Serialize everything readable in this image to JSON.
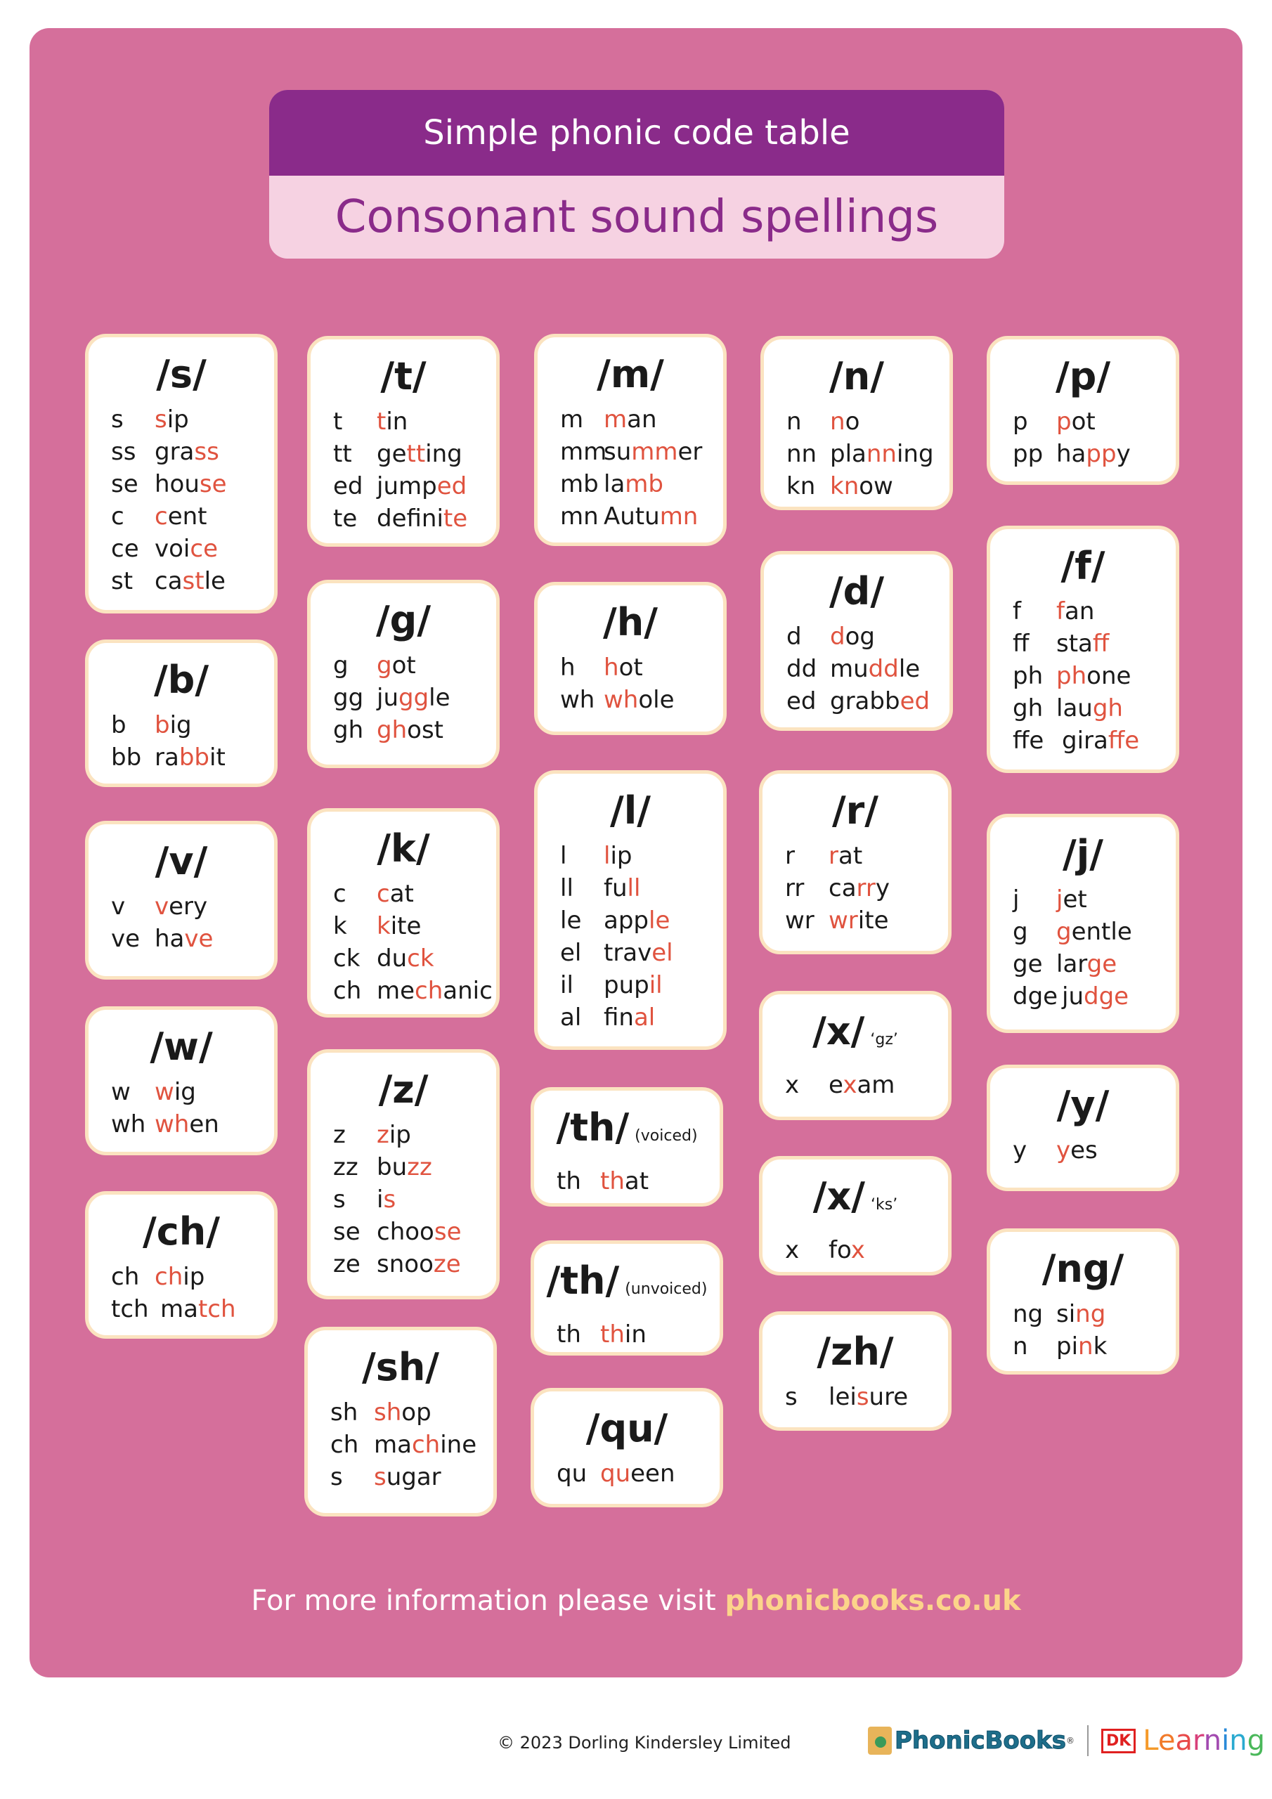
{
  "header": {
    "title": "Simple phonic code table",
    "subtitle": "Consonant sound spellings"
  },
  "colors": {
    "panel": "#d56f9b",
    "title_bar": "#8a2b8a",
    "subtitle_bg": "#f6d2e2",
    "highlight": "#e0533f",
    "link": "#fcd48a"
  },
  "cards": [
    {
      "id": "s",
      "sound": "/s/",
      "note": "",
      "rows": [
        {
          "spelling": "s",
          "word": [
            [
              "",
              "s"
            ],
            [
              "ip",
              ""
            ]
          ]
        },
        {
          "spelling": "ss",
          "word": [
            [
              "gra",
              "ss"
            ]
          ]
        },
        {
          "spelling": "se",
          "word": [
            [
              "hou",
              "se"
            ]
          ]
        },
        {
          "spelling": "c",
          "word": [
            [
              "",
              "c"
            ],
            [
              "ent",
              ""
            ]
          ]
        },
        {
          "spelling": "ce",
          "word": [
            [
              "voi",
              "ce"
            ]
          ]
        },
        {
          "spelling": "st",
          "word": [
            [
              "ca",
              "st"
            ],
            [
              "le",
              ""
            ]
          ]
        }
      ]
    },
    {
      "id": "t",
      "sound": "/t/",
      "note": "",
      "rows": [
        {
          "spelling": "t",
          "word": [
            [
              "",
              "t"
            ],
            [
              "in",
              ""
            ]
          ]
        },
        {
          "spelling": "tt",
          "word": [
            [
              "ge",
              "tt"
            ],
            [
              "ing",
              ""
            ]
          ]
        },
        {
          "spelling": "ed",
          "word": [
            [
              "jump",
              "ed"
            ]
          ]
        },
        {
          "spelling": "te",
          "word": [
            [
              "defini",
              "te"
            ]
          ]
        }
      ]
    },
    {
      "id": "m",
      "sound": "/m/",
      "note": "",
      "rows": [
        {
          "spelling": "m",
          "word": [
            [
              "",
              "m"
            ],
            [
              "an",
              ""
            ]
          ]
        },
        {
          "spelling": "mm",
          "word": [
            [
              "su",
              "mm"
            ],
            [
              "er",
              ""
            ]
          ]
        },
        {
          "spelling": "mb",
          "word": [
            [
              "la",
              "mb"
            ]
          ]
        },
        {
          "spelling": "mn",
          "word": [
            [
              "Autu",
              "mn"
            ]
          ]
        }
      ]
    },
    {
      "id": "n",
      "sound": "/n/",
      "note": "",
      "rows": [
        {
          "spelling": "n",
          "word": [
            [
              "",
              "n"
            ],
            [
              "o",
              ""
            ]
          ]
        },
        {
          "spelling": "nn",
          "word": [
            [
              "pla",
              "nn"
            ],
            [
              "ing",
              ""
            ]
          ]
        },
        {
          "spelling": "kn",
          "word": [
            [
              "",
              "kn"
            ],
            [
              "ow",
              ""
            ]
          ]
        }
      ]
    },
    {
      "id": "p",
      "sound": "/p/",
      "note": "",
      "rows": [
        {
          "spelling": "p",
          "word": [
            [
              "",
              "p"
            ],
            [
              "ot",
              ""
            ]
          ]
        },
        {
          "spelling": "pp",
          "word": [
            [
              "ha",
              "pp"
            ],
            [
              "y",
              ""
            ]
          ]
        }
      ]
    },
    {
      "id": "b",
      "sound": "/b/",
      "note": "",
      "rows": [
        {
          "spelling": "b",
          "word": [
            [
              "",
              "b"
            ],
            [
              "ig",
              ""
            ]
          ]
        },
        {
          "spelling": "bb",
          "word": [
            [
              "ra",
              "bb"
            ],
            [
              "it",
              ""
            ]
          ]
        }
      ]
    },
    {
      "id": "g",
      "sound": "/g/",
      "note": "",
      "rows": [
        {
          "spelling": "g",
          "word": [
            [
              "",
              "g"
            ],
            [
              "ot",
              ""
            ]
          ]
        },
        {
          "spelling": "gg",
          "word": [
            [
              "ju",
              "gg"
            ],
            [
              "le",
              ""
            ]
          ]
        },
        {
          "spelling": "gh",
          "word": [
            [
              "",
              "gh"
            ],
            [
              "ost",
              ""
            ]
          ]
        }
      ]
    },
    {
      "id": "h",
      "sound": "/h/",
      "note": "",
      "rows": [
        {
          "spelling": "h",
          "word": [
            [
              "",
              "h"
            ],
            [
              "ot",
              ""
            ]
          ]
        },
        {
          "spelling": "wh",
          "word": [
            [
              "",
              "wh"
            ],
            [
              "ole",
              ""
            ]
          ]
        }
      ]
    },
    {
      "id": "d",
      "sound": "/d/",
      "note": "",
      "rows": [
        {
          "spelling": "d",
          "word": [
            [
              "",
              "d"
            ],
            [
              "og",
              ""
            ]
          ]
        },
        {
          "spelling": "dd",
          "word": [
            [
              "mu",
              "dd"
            ],
            [
              "le",
              ""
            ]
          ]
        },
        {
          "spelling": "ed",
          "word": [
            [
              "grabb",
              "ed"
            ]
          ]
        }
      ]
    },
    {
      "id": "f",
      "sound": "/f/",
      "note": "",
      "rows": [
        {
          "spelling": "f",
          "word": [
            [
              "",
              "f"
            ],
            [
              "an",
              ""
            ]
          ]
        },
        {
          "spelling": "ff",
          "word": [
            [
              "sta",
              "ff"
            ]
          ]
        },
        {
          "spelling": "ph",
          "word": [
            [
              "",
              "ph"
            ],
            [
              "one",
              ""
            ]
          ]
        },
        {
          "spelling": "gh",
          "word": [
            [
              "lau",
              "gh"
            ]
          ]
        },
        {
          "spelling": "ffe",
          "word": [
            [
              "gira",
              "ffe"
            ]
          ]
        }
      ]
    },
    {
      "id": "v",
      "sound": "/v/",
      "note": "",
      "rows": [
        {
          "spelling": "v",
          "word": [
            [
              "",
              "v"
            ],
            [
              "ery",
              ""
            ]
          ]
        },
        {
          "spelling": "ve",
          "word": [
            [
              "ha",
              "ve"
            ]
          ]
        }
      ]
    },
    {
      "id": "k",
      "sound": "/k/",
      "note": "",
      "rows": [
        {
          "spelling": "c",
          "word": [
            [
              "",
              "c"
            ],
            [
              "at",
              ""
            ]
          ]
        },
        {
          "spelling": "k",
          "word": [
            [
              "",
              "k"
            ],
            [
              "ite",
              ""
            ]
          ]
        },
        {
          "spelling": "ck",
          "word": [
            [
              "du",
              "ck"
            ]
          ]
        },
        {
          "spelling": "ch",
          "word": [
            [
              "me",
              "ch"
            ],
            [
              "anic",
              ""
            ]
          ]
        }
      ]
    },
    {
      "id": "l",
      "sound": "/l/",
      "note": "",
      "rows": [
        {
          "spelling": "l",
          "word": [
            [
              "",
              "l"
            ],
            [
              "ip",
              ""
            ]
          ]
        },
        {
          "spelling": "ll",
          "word": [
            [
              "fu",
              "ll"
            ]
          ]
        },
        {
          "spelling": "le",
          "word": [
            [
              "app",
              "le"
            ]
          ]
        },
        {
          "spelling": "el",
          "word": [
            [
              "trav",
              "el"
            ]
          ]
        },
        {
          "spelling": "il",
          "word": [
            [
              "pup",
              "il"
            ]
          ]
        },
        {
          "spelling": "al",
          "word": [
            [
              "fin",
              "al"
            ]
          ]
        }
      ]
    },
    {
      "id": "r",
      "sound": "/r/",
      "note": "",
      "rows": [
        {
          "spelling": "r",
          "word": [
            [
              "",
              "r"
            ],
            [
              "at",
              ""
            ]
          ]
        },
        {
          "spelling": "rr",
          "word": [
            [
              "ca",
              "rr"
            ],
            [
              "y",
              ""
            ]
          ]
        },
        {
          "spelling": "wr",
          "word": [
            [
              "",
              "wr"
            ],
            [
              "ite",
              ""
            ]
          ]
        }
      ]
    },
    {
      "id": "j",
      "sound": "/j/",
      "note": "",
      "rows": [
        {
          "spelling": "j",
          "word": [
            [
              "",
              "j"
            ],
            [
              "et",
              ""
            ]
          ]
        },
        {
          "spelling": "g",
          "word": [
            [
              "",
              "g"
            ],
            [
              "entle",
              ""
            ]
          ]
        },
        {
          "spelling": "ge",
          "word": [
            [
              "lar",
              "ge"
            ]
          ]
        },
        {
          "spelling": "dge",
          "word": [
            [
              "ju",
              "dge"
            ]
          ]
        }
      ]
    },
    {
      "id": "w",
      "sound": "/w/",
      "note": "",
      "rows": [
        {
          "spelling": "w",
          "word": [
            [
              "",
              "w"
            ],
            [
              "ig",
              ""
            ]
          ]
        },
        {
          "spelling": "wh",
          "word": [
            [
              "",
              "wh"
            ],
            [
              "en",
              ""
            ]
          ]
        }
      ]
    },
    {
      "id": "z",
      "sound": "/z/",
      "note": "",
      "rows": [
        {
          "spelling": "z",
          "word": [
            [
              "",
              "z"
            ],
            [
              "ip",
              ""
            ]
          ]
        },
        {
          "spelling": "zz",
          "word": [
            [
              "bu",
              "zz"
            ]
          ]
        },
        {
          "spelling": "s",
          "word": [
            [
              "i",
              "s"
            ]
          ]
        },
        {
          "spelling": "se",
          "word": [
            [
              "choo",
              "se"
            ]
          ]
        },
        {
          "spelling": "ze",
          "word": [
            [
              "snoo",
              "ze"
            ]
          ]
        }
      ]
    },
    {
      "id": "x-gz",
      "sound": "/x/",
      "note": "‘gz’",
      "rows": [
        {
          "spelling": "x",
          "word": [
            [
              "e",
              "x"
            ],
            [
              "am",
              ""
            ]
          ]
        }
      ]
    },
    {
      "id": "th-voiced",
      "sound": "/th/",
      "note": "(voiced)",
      "rows": [
        {
          "spelling": "th",
          "word": [
            [
              "",
              "th"
            ],
            [
              "at",
              ""
            ]
          ]
        }
      ]
    },
    {
      "id": "y",
      "sound": "/y/",
      "note": "",
      "rows": [
        {
          "spelling": "y",
          "word": [
            [
              "",
              "y"
            ],
            [
              "es",
              ""
            ]
          ]
        }
      ]
    },
    {
      "id": "ch",
      "sound": "/ch/",
      "note": "",
      "rows": [
        {
          "spelling": "ch",
          "word": [
            [
              "",
              "ch"
            ],
            [
              "ip",
              ""
            ]
          ]
        },
        {
          "spelling": "tch",
          "word": [
            [
              "ma",
              "tch"
            ]
          ]
        }
      ]
    },
    {
      "id": "x-ks",
      "sound": "/x/",
      "note": "‘ks’",
      "rows": [
        {
          "spelling": "x",
          "word": [
            [
              "fo",
              "x"
            ]
          ]
        }
      ]
    },
    {
      "id": "th-unvoiced",
      "sound": "/th/",
      "note": "(unvoiced)",
      "rows": [
        {
          "spelling": "th",
          "word": [
            [
              "",
              "th"
            ],
            [
              "in",
              ""
            ]
          ]
        }
      ]
    },
    {
      "id": "ng",
      "sound": "/ng/",
      "note": "",
      "rows": [
        {
          "spelling": "ng",
          "word": [
            [
              "si",
              "ng"
            ]
          ]
        },
        {
          "spelling": "n",
          "word": [
            [
              "pi",
              "n"
            ],
            [
              "k",
              ""
            ]
          ]
        }
      ]
    },
    {
      "id": "sh",
      "sound": "/sh/",
      "note": "",
      "rows": [
        {
          "spelling": "sh",
          "word": [
            [
              "",
              "sh"
            ],
            [
              "op",
              ""
            ]
          ]
        },
        {
          "spelling": "ch",
          "word": [
            [
              "ma",
              "ch"
            ],
            [
              "ine",
              ""
            ]
          ]
        },
        {
          "spelling": "s",
          "word": [
            [
              "",
              "s"
            ],
            [
              "ugar",
              ""
            ]
          ]
        }
      ]
    },
    {
      "id": "zh",
      "sound": "/zh/",
      "note": "",
      "rows": [
        {
          "spelling": "s",
          "word": [
            [
              "lei",
              "s"
            ],
            [
              "ure",
              ""
            ]
          ]
        }
      ]
    },
    {
      "id": "qu",
      "sound": "/qu/",
      "note": "",
      "rows": [
        {
          "spelling": "qu",
          "word": [
            [
              "",
              "qu"
            ],
            [
              "een",
              ""
            ]
          ]
        }
      ]
    }
  ],
  "footer": {
    "info_text": "For more information please visit ",
    "link_text": "phonicbooks.co.uk",
    "copyright": "© 2023 Dorling Kindersley Limited",
    "logo_phonicbooks": "PhonicBooks",
    "logo_reg": "®",
    "logo_dk": "DK",
    "logo_learning": [
      "L",
      "e",
      "a",
      "r",
      "n",
      "i",
      "n",
      "g"
    ]
  }
}
